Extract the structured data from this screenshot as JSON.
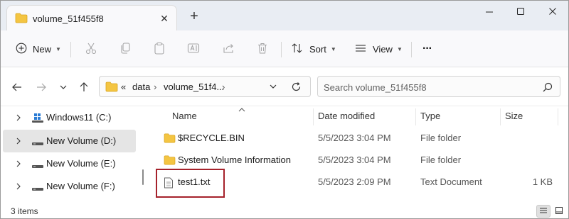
{
  "window": {
    "tab_title": "volume_51f455f8",
    "tab_close_glyph": "✕",
    "new_tab_glyph": "+"
  },
  "toolbar": {
    "new_label": "New",
    "sort_label": "Sort",
    "view_label": "View",
    "more_glyph": "···"
  },
  "address": {
    "overflow": "«",
    "crumbs": [
      "data",
      "volume_51f4...",
      "›"
    ],
    "separator": "›"
  },
  "search": {
    "placeholder": "Search volume_51f455f8"
  },
  "sidebar": {
    "items": [
      {
        "label": "Windows11 (C:)",
        "icon": "windows-drive-icon",
        "selected": false
      },
      {
        "label": "New Volume (D:)",
        "icon": "drive-icon",
        "selected": true
      },
      {
        "label": "New Volume (E:)",
        "icon": "drive-icon",
        "selected": false
      },
      {
        "label": "New Volume (F:)",
        "icon": "drive-icon",
        "selected": false
      }
    ]
  },
  "filelist": {
    "columns": {
      "name": "Name",
      "date": "Date modified",
      "type": "Type",
      "size": "Size"
    },
    "rows": [
      {
        "name": "$RECYCLE.BIN",
        "date": "5/5/2023 3:04 PM",
        "type": "File folder",
        "size": "",
        "icon": "folder-icon"
      },
      {
        "name": "System Volume Information",
        "date": "5/5/2023 3:04 PM",
        "type": "File folder",
        "size": "",
        "icon": "folder-icon"
      },
      {
        "name": "test1.txt",
        "date": "5/5/2023 2:09 PM",
        "type": "Text Document",
        "size": "1 KB",
        "icon": "text-file-icon"
      }
    ]
  },
  "status": {
    "item_count": "3 items"
  },
  "colors": {
    "folder": "#f4c542",
    "highlight_box": "#a5222b",
    "selected_bg": "#e5e5e5"
  }
}
